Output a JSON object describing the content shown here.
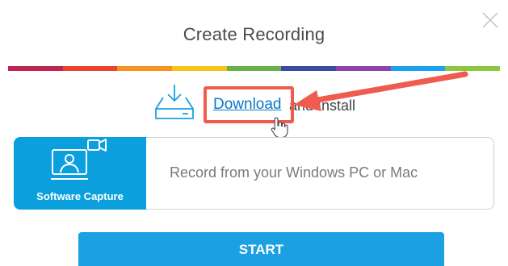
{
  "dialog": {
    "title": "Create Recording",
    "close_icon": "close-x-icon"
  },
  "stripe": {
    "colors": [
      "#c0254f",
      "#e8452c",
      "#f7931e",
      "#f9c21b",
      "#6ab04c",
      "#3d4aa2",
      "#8e44ad",
      "#1da1f2",
      "#8dc63f"
    ]
  },
  "download": {
    "icon": "download-tray-icon",
    "link_label": "Download",
    "suffix": " and Install"
  },
  "option": {
    "tile_icon": "webcam-monitor-icon",
    "tile_label": "Software Capture",
    "description": "Record from your Windows PC or Mac"
  },
  "colors": {
    "accent": "#1aa0e3",
    "tile": "#0b9fde",
    "annotation": "#ef5b4e",
    "link": "#0b76c8"
  },
  "actions": {
    "start_label": "START"
  }
}
